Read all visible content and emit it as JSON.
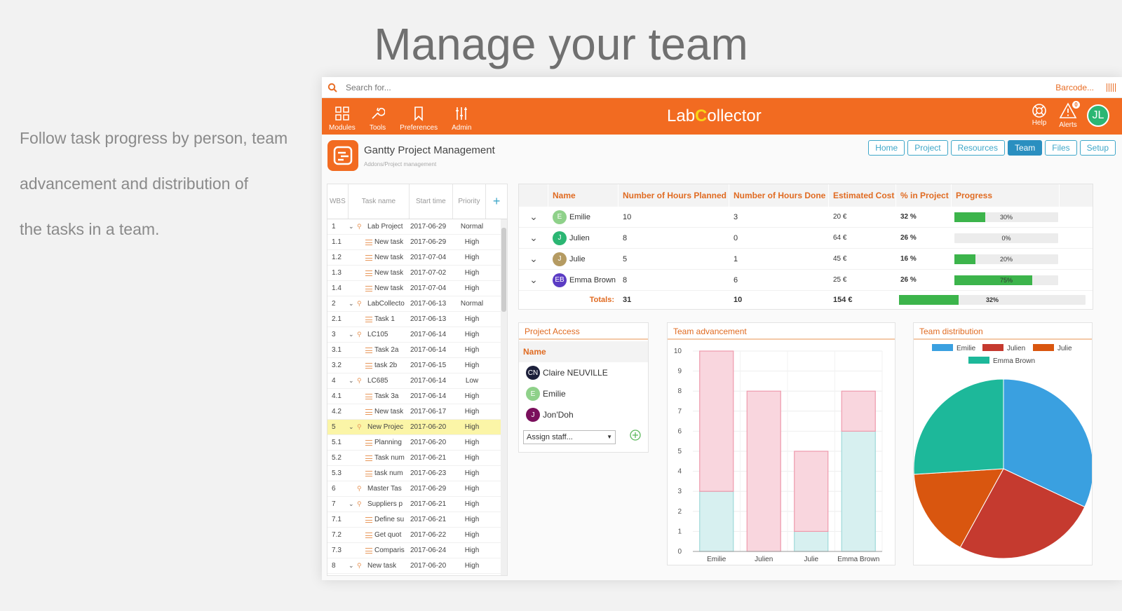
{
  "hero": {
    "title": "Manage your team",
    "lines": [
      "Follow task progress by person, team",
      "advancement and distribution of",
      "the tasks in a team."
    ]
  },
  "search": {
    "placeholder": "Search for...",
    "barcode": "Barcode..."
  },
  "nav": {
    "brand_lab": "Lab",
    "brand_c": "C",
    "brand_rest": "ollector",
    "items": [
      {
        "label": "Modules",
        "icon": "grid-icon"
      },
      {
        "label": "Tools",
        "icon": "wrench-icon"
      },
      {
        "label": "Preferences",
        "icon": "bookmark-icon"
      },
      {
        "label": "Admin",
        "icon": "sliders-icon"
      }
    ],
    "help": "Help",
    "alerts": "Alerts",
    "alerts_count": "0",
    "user_initials": "JL"
  },
  "page": {
    "title": "Gantty Project Management",
    "breadcrumb": "Addons/Project management",
    "tabs": [
      "Home",
      "Project",
      "Resources",
      "Team",
      "Files",
      "Setup"
    ],
    "active_tab": "Team"
  },
  "gantt": {
    "headers": [
      "WBS",
      "Task name",
      "Start time",
      "Priority",
      "+"
    ],
    "rows": [
      {
        "wbs": "1",
        "name": "Lab Project",
        "start": "2017-06-29",
        "priority": "Normal",
        "type": "project",
        "collapse": true
      },
      {
        "wbs": "1.1",
        "name": "New task",
        "start": "2017-06-29",
        "priority": "High",
        "type": "task"
      },
      {
        "wbs": "1.2",
        "name": "New task",
        "start": "2017-07-04",
        "priority": "High",
        "type": "task"
      },
      {
        "wbs": "1.3",
        "name": "New task",
        "start": "2017-07-02",
        "priority": "High",
        "type": "task"
      },
      {
        "wbs": "1.4",
        "name": "New task",
        "start": "2017-07-04",
        "priority": "High",
        "type": "task"
      },
      {
        "wbs": "2",
        "name": "LabCollecto",
        "start": "2017-06-13",
        "priority": "Normal",
        "type": "project",
        "collapse": true
      },
      {
        "wbs": "2.1",
        "name": "Task 1",
        "start": "2017-06-13",
        "priority": "High",
        "type": "task"
      },
      {
        "wbs": "3",
        "name": "LC105",
        "start": "2017-06-14",
        "priority": "High",
        "type": "project",
        "collapse": true
      },
      {
        "wbs": "3.1",
        "name": "Task 2a",
        "start": "2017-06-14",
        "priority": "High",
        "type": "task"
      },
      {
        "wbs": "3.2",
        "name": "task 2b",
        "start": "2017-06-15",
        "priority": "High",
        "type": "task"
      },
      {
        "wbs": "4",
        "name": "LC685",
        "start": "2017-06-14",
        "priority": "Low",
        "type": "project",
        "collapse": true
      },
      {
        "wbs": "4.1",
        "name": "Task 3a",
        "start": "2017-06-14",
        "priority": "High",
        "type": "task"
      },
      {
        "wbs": "4.2",
        "name": "New task",
        "start": "2017-06-17",
        "priority": "High",
        "type": "task"
      },
      {
        "wbs": "5",
        "name": "New Projec",
        "start": "2017-06-20",
        "priority": "High",
        "type": "project",
        "collapse": true,
        "highlight": true
      },
      {
        "wbs": "5.1",
        "name": "Planning",
        "start": "2017-06-20",
        "priority": "High",
        "type": "task"
      },
      {
        "wbs": "5.2",
        "name": "Task num",
        "start": "2017-06-21",
        "priority": "High",
        "type": "task"
      },
      {
        "wbs": "5.3",
        "name": "task num",
        "start": "2017-06-23",
        "priority": "High",
        "type": "task"
      },
      {
        "wbs": "6",
        "name": "Master Tas",
        "start": "2017-06-29",
        "priority": "High",
        "type": "project",
        "collapse": false
      },
      {
        "wbs": "7",
        "name": "Suppliers p",
        "start": "2017-06-21",
        "priority": "High",
        "type": "project",
        "collapse": true
      },
      {
        "wbs": "7.1",
        "name": "Define su",
        "start": "2017-06-21",
        "priority": "High",
        "type": "task"
      },
      {
        "wbs": "7.2",
        "name": "Get quot",
        "start": "2017-06-22",
        "priority": "High",
        "type": "task"
      },
      {
        "wbs": "7.3",
        "name": "Comparis",
        "start": "2017-06-24",
        "priority": "High",
        "type": "task"
      },
      {
        "wbs": "8",
        "name": "New task",
        "start": "2017-06-20",
        "priority": "High",
        "type": "project",
        "collapse": true
      }
    ]
  },
  "team": {
    "headers": [
      "Name",
      "Number of Hours Planned",
      "Number of Hours Done",
      "Estimated Cost",
      "% in Project",
      "Progress"
    ],
    "members": [
      {
        "initials": "E",
        "name": "Emilie",
        "color": "#8fd18a",
        "planned": "10",
        "done": "3",
        "cost": "20 €",
        "pct": "32 %",
        "progress": 30,
        "progress_label": "30%"
      },
      {
        "initials": "J",
        "name": "Julien",
        "color": "#2bb673",
        "planned": "8",
        "done": "0",
        "cost": "64 €",
        "pct": "26 %",
        "progress": 0,
        "progress_label": "0%"
      },
      {
        "initials": "J",
        "name": "Julie",
        "color": "#b59b62",
        "planned": "5",
        "done": "1",
        "cost": "45 €",
        "pct": "16 %",
        "progress": 20,
        "progress_label": "20%"
      },
      {
        "initials": "EB",
        "name": "Emma Brown",
        "color": "#5b3cc4",
        "planned": "8",
        "done": "6",
        "cost": "25 €",
        "pct": "26 %",
        "progress": 75,
        "progress_label": "75%"
      }
    ],
    "totals": {
      "label": "Totals:",
      "planned": "31",
      "done": "10",
      "cost": "154 €",
      "progress": 32,
      "progress_label": "32%"
    }
  },
  "access": {
    "title": "Project Access",
    "header": "Name",
    "people": [
      {
        "initials": "CN",
        "name": "Claire NEUVILLE",
        "color": "#1c1f3a"
      },
      {
        "initials": "E",
        "name": "Emilie",
        "color": "#8fd18a"
      },
      {
        "initials": "J",
        "name": "Jon'Doh",
        "color": "#7a0f5c"
      }
    ],
    "assign_placeholder": "Assign staff..."
  },
  "chart_data": [
    {
      "type": "bar",
      "title": "Team advancement",
      "categories": [
        "Emilie",
        "Julien",
        "Julie",
        "Emma Brown"
      ],
      "series": [
        {
          "values": [
            3,
            0,
            1,
            6
          ],
          "color": "#d7f0f0"
        },
        {
          "values": [
            7,
            8,
            4,
            2
          ],
          "color": "#f9d6de"
        }
      ],
      "stacked": true,
      "ylim": [
        0,
        10
      ],
      "yticks": [
        "0",
        "1",
        "2",
        "3",
        "4",
        "5",
        "6",
        "7",
        "8",
        "9",
        "10"
      ],
      "grid": true
    },
    {
      "type": "pie",
      "title": "Team distribution",
      "legend": "top",
      "labels": [
        "Emilie",
        "Julien",
        "Julie",
        "Emma Brown"
      ],
      "values": [
        32,
        26,
        16,
        26
      ],
      "colors": [
        "#3aa0e0",
        "#c53a2f",
        "#d9560f",
        "#1db89a"
      ]
    }
  ]
}
